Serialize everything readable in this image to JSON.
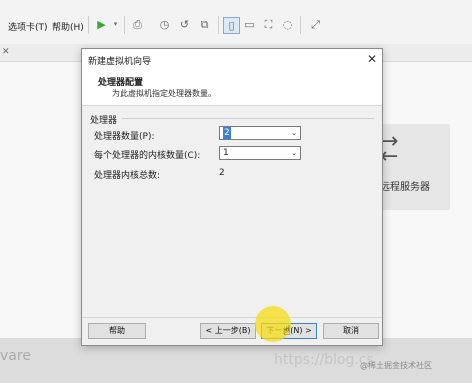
{
  "app": {
    "menu": [
      {
        "label": "选项卡(T)"
      },
      {
        "label": "帮助(H)"
      }
    ],
    "toolbar_icons": [
      "play-icon",
      "dropdown-icon",
      "print-icon",
      "snapshot-icon",
      "revert-icon",
      "manage-snapshots-icon",
      "fit-window-icon",
      "console-icon",
      "fullscreen-icon",
      "unity-icon",
      "stretch-icon"
    ],
    "remote_card_label": "远程服务器",
    "brand_fragment": "vare",
    "watermark": "https://blog.cs",
    "watermark2": "@稀土掘金技术社区"
  },
  "dialog": {
    "title": "新建虚拟机向导",
    "header_title": "处理器配置",
    "header_subtitle": "为此虚拟机指定处理器数量。",
    "group_label": "处理器",
    "fields": [
      {
        "label": "处理器数量(P):",
        "value": "2"
      },
      {
        "label": "每个处理器的内核数量(C):",
        "value": "1"
      }
    ],
    "total_label": "处理器内核总数:",
    "total_value": "2",
    "buttons": {
      "help": "帮助",
      "back": "< 上一步(B)",
      "next": "下一步(N) >",
      "cancel": "取消"
    }
  }
}
